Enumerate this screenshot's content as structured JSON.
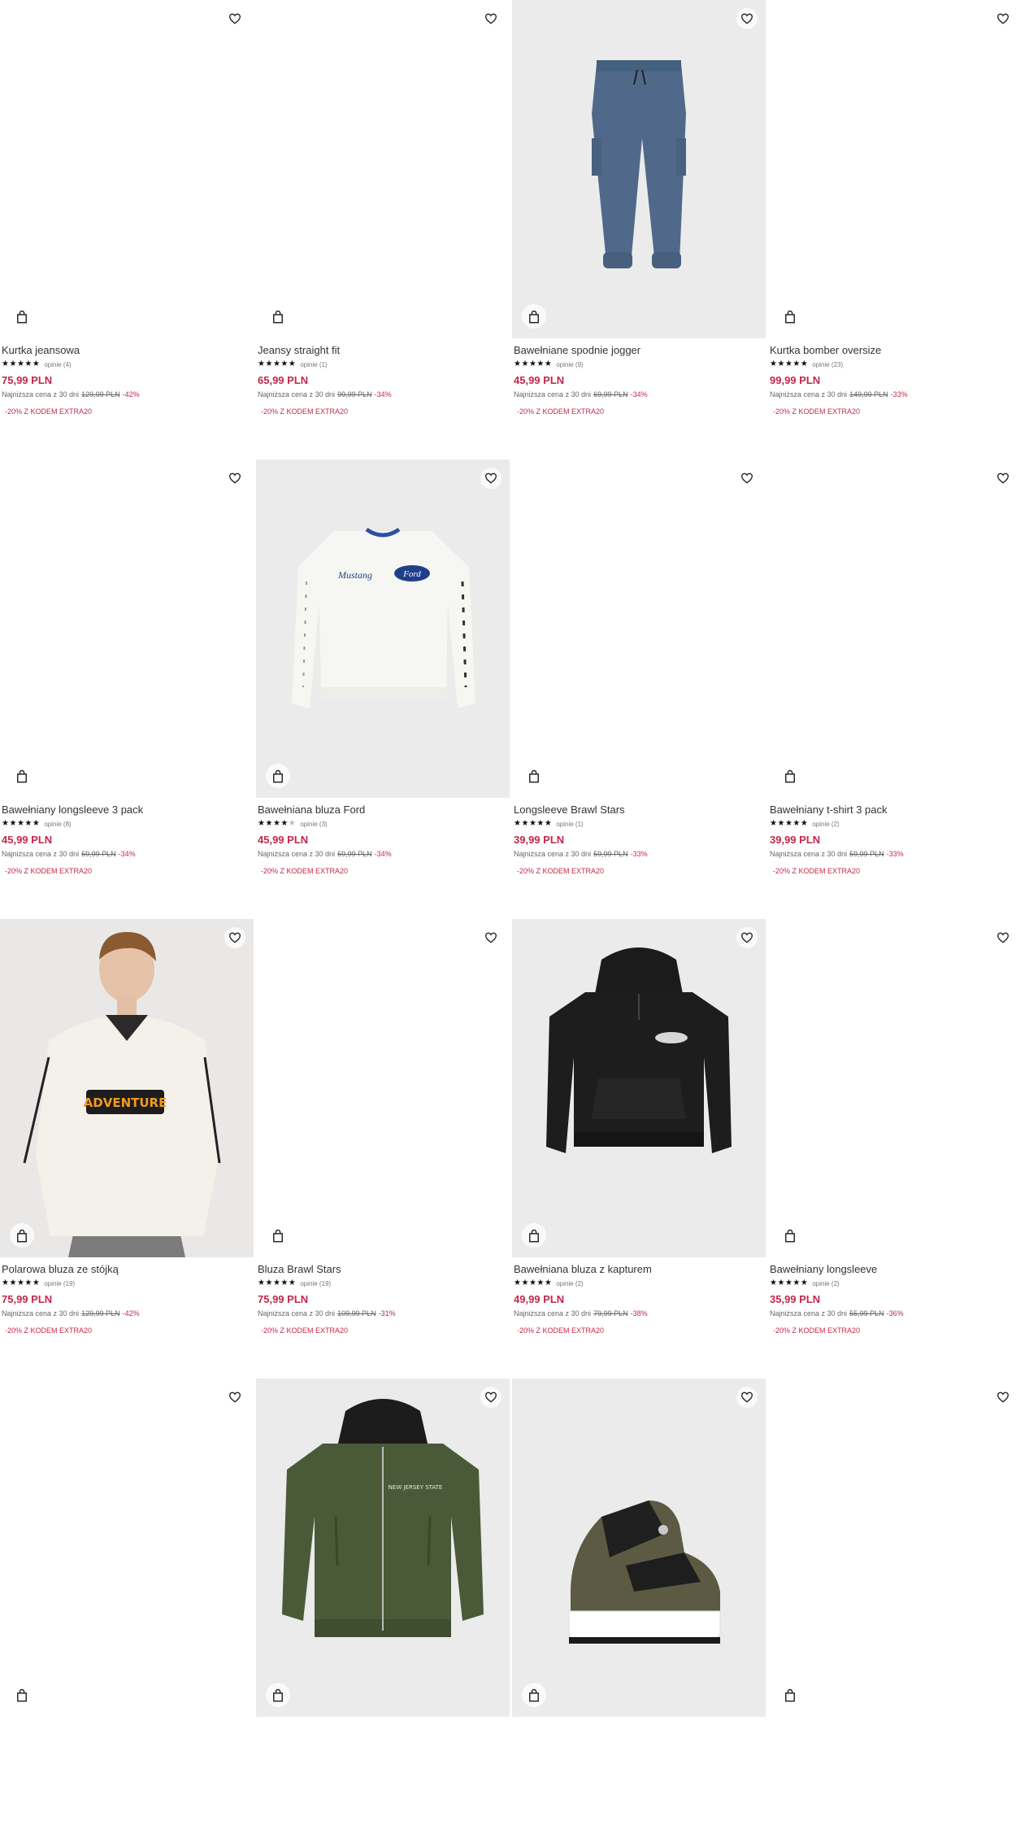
{
  "labels": {
    "lowest_price_text": "Najniższa cena z 30 dni",
    "promo_text": "-20% Z KODEM EXTRA20"
  },
  "icons": {
    "wishlist": "heart-icon",
    "cart": "shopping-bag-icon"
  },
  "colors": {
    "sale_price": "#c4284a",
    "photo_background": "#ebebeb"
  },
  "products": [
    {
      "name": "Kurtka jeansowa",
      "rating": 5,
      "reviews": "opinie (4)",
      "price": "75,99 PLN",
      "old_price": "129,99 PLN",
      "discount": "-42%",
      "image": "none"
    },
    {
      "name": "Jeansy straight fit",
      "rating": 5,
      "reviews": "opinie (1)",
      "price": "65,99 PLN",
      "old_price": "99,99 PLN",
      "discount": "-34%",
      "image": "none"
    },
    {
      "name": "Bawełniane spodnie jogger",
      "rating": 5,
      "reviews": "opinie (9)",
      "price": "45,99 PLN",
      "old_price": "69,99 PLN",
      "discount": "-34%",
      "image": "jogger-pants"
    },
    {
      "name": "Kurtka bomber oversize",
      "rating": 5,
      "reviews": "opinie (23)",
      "price": "99,99 PLN",
      "old_price": "149,99 PLN",
      "discount": "-33%",
      "image": "none"
    },
    {
      "name": "Bawełniany longsleeve 3 pack",
      "rating": 5,
      "reviews": "opinie (8)",
      "price": "45,99 PLN",
      "old_price": "69,99 PLN",
      "discount": "-34%",
      "image": "none"
    },
    {
      "name": "Bawełniana bluza Ford",
      "rating": 4.5,
      "reviews": "opinie (3)",
      "price": "45,99 PLN",
      "old_price": "69,99 PLN",
      "discount": "-34%",
      "image": "ford-sweatshirt"
    },
    {
      "name": "Longsleeve Brawl Stars",
      "rating": 5,
      "reviews": "opinie (1)",
      "price": "39,99 PLN",
      "old_price": "59,99 PLN",
      "discount": "-33%",
      "image": "none"
    },
    {
      "name": "Bawełniany t-shirt 3 pack",
      "rating": 5,
      "reviews": "opinie (2)",
      "price": "39,99 PLN",
      "old_price": "59,99 PLN",
      "discount": "-33%",
      "image": "none"
    },
    {
      "name": "Polarowa bluza ze stójką",
      "rating": 5,
      "reviews": "opinie (19)",
      "price": "75,99 PLN",
      "old_price": "129,99 PLN",
      "discount": "-42%",
      "image": "fleece-model"
    },
    {
      "name": "Bluza Brawl Stars",
      "rating": 5,
      "reviews": "opinie (19)",
      "price": "75,99 PLN",
      "old_price": "109,99 PLN",
      "discount": "-31%",
      "image": "none"
    },
    {
      "name": "Bawełniana bluza z kapturem",
      "rating": 5,
      "reviews": "opinie (2)",
      "price": "49,99 PLN",
      "old_price": "79,99 PLN",
      "discount": "-38%",
      "image": "black-hoodie"
    },
    {
      "name": "Bawełniany longsleeve",
      "rating": 5,
      "reviews": "opinie (2)",
      "price": "35,99 PLN",
      "old_price": "55,99 PLN",
      "discount": "-36%",
      "image": "none"
    },
    {
      "image": "none"
    },
    {
      "image": "green-bomber"
    },
    {
      "image": "sneaker"
    },
    {
      "image": "none"
    }
  ],
  "artwork_text": {
    "ford_logo": "Ford",
    "mustang_script": "Mustang",
    "adventure_patch": "ADVENTURE",
    "bomber_print": "NEW JERSEY STATE"
  }
}
